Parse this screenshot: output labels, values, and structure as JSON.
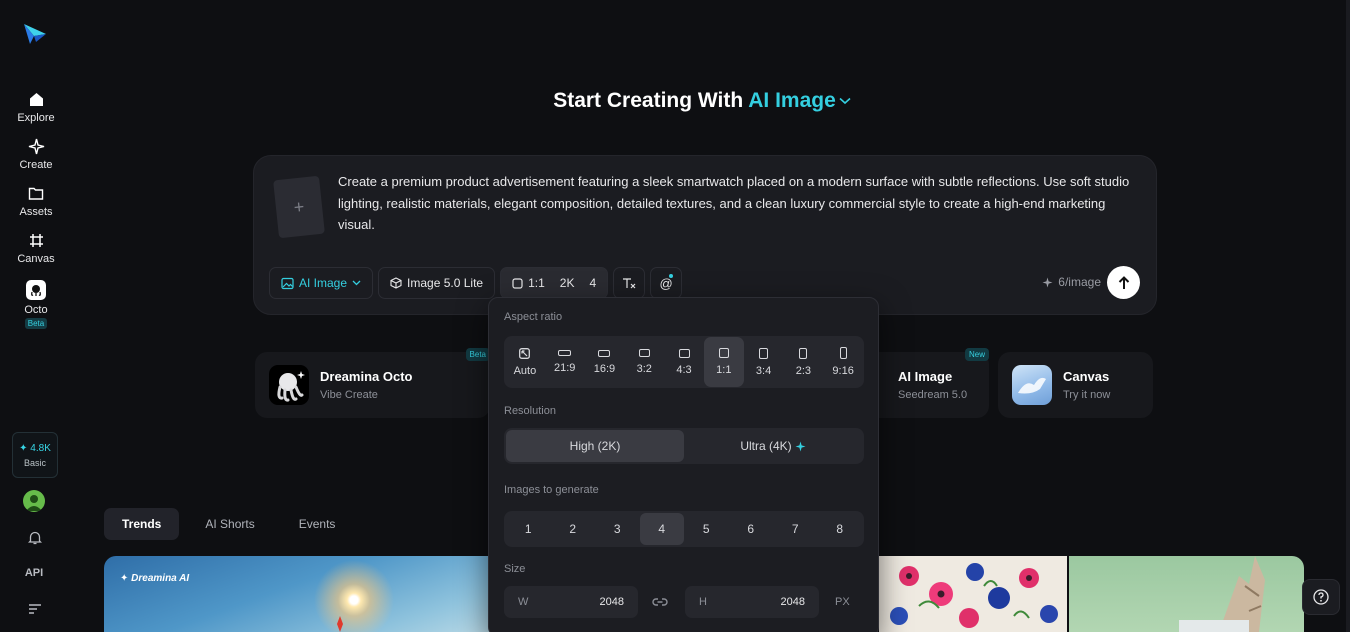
{
  "sidebar": {
    "nav": [
      {
        "label": "Explore",
        "icon": "home-icon"
      },
      {
        "label": "Create",
        "icon": "sparkle-icon"
      },
      {
        "label": "Assets",
        "icon": "folder-icon"
      },
      {
        "label": "Canvas",
        "icon": "canvas-grid-icon"
      },
      {
        "label": "Octo",
        "icon": "octo-icon",
        "badge": "Beta"
      }
    ],
    "credits": {
      "amount": "4.8K",
      "plan": "Basic"
    },
    "api_label": "API"
  },
  "title": {
    "prefix": "Start Creating With",
    "accent": "AI Image"
  },
  "prompt": {
    "text": "Create a premium product advertisement featuring a sleek smartwatch placed on a modern surface with subtle reflections. Use soft studio lighting, realistic materials, elegant composition, detailed textures, and a clean luxury commercial style to create a high-end marketing visual.",
    "mode_label": "AI Image",
    "model_label": "Image 5.0 Lite",
    "settings": {
      "ratio": "1:1",
      "resolution": "2K",
      "count": "4"
    },
    "cost": "6/image"
  },
  "features": [
    {
      "name": "Dreamina Octo",
      "sub": "Vibe Create",
      "tag": "Beta"
    },
    {
      "name": "AI Image",
      "sub": "Seedream 5.0",
      "tag": "New"
    },
    {
      "name": "Canvas",
      "sub": "Try it now"
    }
  ],
  "tabs": [
    "Trends",
    "AI Shorts",
    "Events"
  ],
  "gallery": {
    "watermark": "Dreamina AI"
  },
  "popover": {
    "aspect_label": "Aspect ratio",
    "ratios": [
      "Auto",
      "21:9",
      "16:9",
      "3:2",
      "4:3",
      "1:1",
      "3:4",
      "2:3",
      "9:16"
    ],
    "selected_ratio": "1:1",
    "resolution_label": "Resolution",
    "resolutions": [
      "High (2K)",
      "Ultra (4K)"
    ],
    "count_label": "Images to generate",
    "counts": [
      "1",
      "2",
      "3",
      "4",
      "5",
      "6",
      "7",
      "8"
    ],
    "selected_count": "4",
    "size_label": "Size",
    "width_key": "W",
    "width": "2048",
    "height_key": "H",
    "height": "2048",
    "unit": "PX"
  },
  "colors": {
    "accent": "#34cfe0",
    "bg": "#0e0f12",
    "card": "#1b1c21"
  }
}
